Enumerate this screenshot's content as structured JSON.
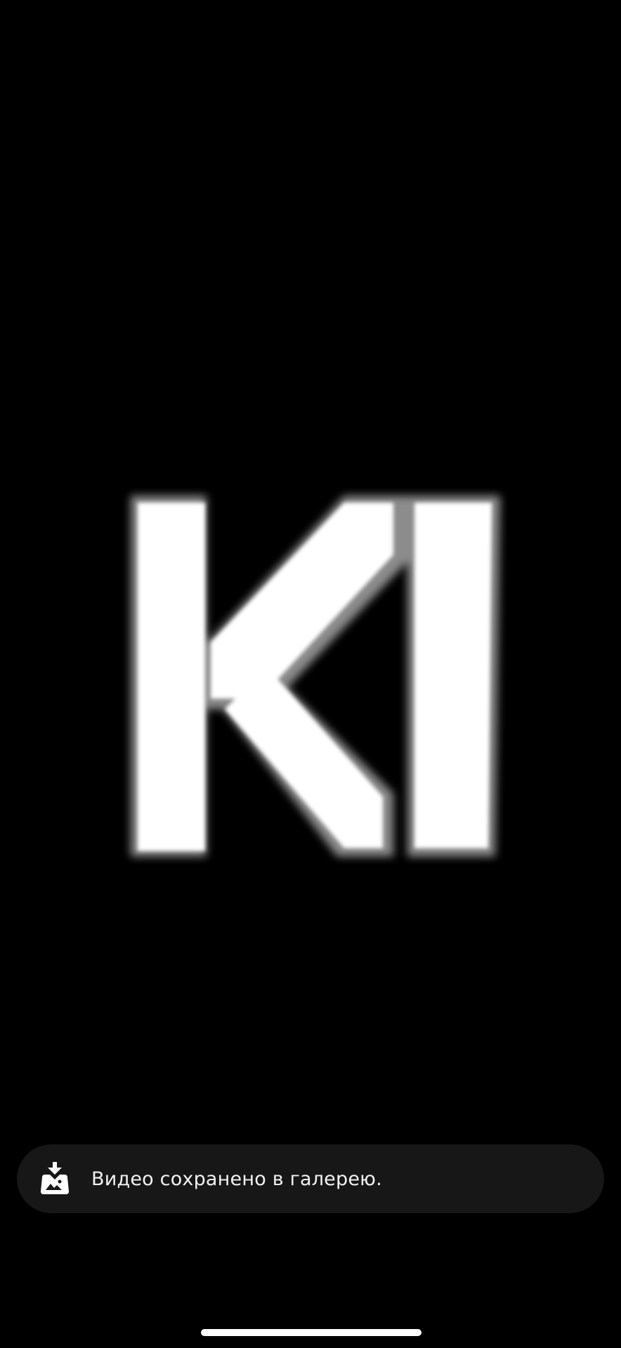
{
  "toast": {
    "icon": "save-to-gallery-icon",
    "message": "Видео сохранено в галерею."
  },
  "video": {
    "logo": "k1-logo"
  },
  "colors": {
    "background": "#000000",
    "toast_background": "#171717",
    "toast_text": "#f2f2f2",
    "logo": "#ffffff"
  }
}
